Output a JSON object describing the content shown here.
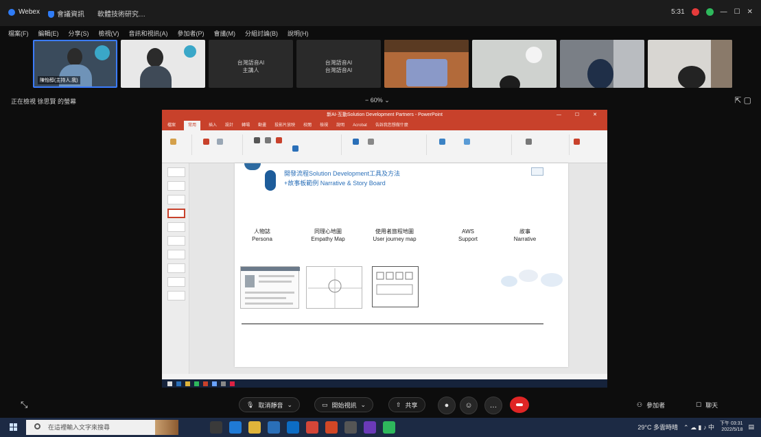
{
  "window": {
    "app_name": "Webex",
    "tab_label": "會議資訊",
    "meeting_name": "軟體技術研究…",
    "time": "5:31",
    "colors": {
      "red_dot": "#e53b3b",
      "green_dot": "#2eb85c"
    }
  },
  "menu": [
    "檔案(F)",
    "編輯(E)",
    "分享(S)",
    "檢視(V)",
    "音訊和視訊(A)",
    "參加者(P)",
    "會議(M)",
    "分組討論(B)",
    "說明(H)"
  ],
  "participants": [
    {
      "kind": "video",
      "label": "陳怡醇(主持人,我)",
      "active": true
    },
    {
      "kind": "video",
      "label": "",
      "active": false
    },
    {
      "kind": "name",
      "name": "台灣語音AI",
      "sub": "主講人",
      "active": false
    },
    {
      "kind": "name",
      "name": "台灣語音AI",
      "sub": "台灣語音AI",
      "active": false
    },
    {
      "kind": "video",
      "label": "",
      "active": false
    },
    {
      "kind": "video",
      "label": "",
      "active": false
    },
    {
      "kind": "video",
      "label": "",
      "active": false
    },
    {
      "kind": "video",
      "label": "",
      "active": false
    }
  ],
  "status": {
    "sharing_text": "正在檢視 徐思賢 的螢幕",
    "zoom": "60%"
  },
  "powerpoint": {
    "title": "新AI-互動Solution Development Partners - PowerPoint",
    "tabs": [
      "檔案",
      "常用",
      "插入",
      "設計",
      "轉場",
      "動畫",
      "投影片放映",
      "校閱",
      "檢視",
      "說明",
      "Acrobat",
      "告訴我您想做什麼"
    ],
    "active_tab": "常用",
    "slide": {
      "title_line1": "開發流程Solution Development工具及方法",
      "title_line2": "+故事板範例 Narrative & Story Board",
      "columns": [
        {
          "zh": "人物誌",
          "en": "Persona"
        },
        {
          "zh": "同理心地圖",
          "en": "Empathy Map"
        },
        {
          "zh": "使用者旅程地圖",
          "en": "User journey map"
        },
        {
          "zh": "AWS",
          "en": "Support"
        },
        {
          "zh": "故事",
          "en": "Narrative"
        }
      ]
    }
  },
  "controls": {
    "mute_label": "取消靜音",
    "video_label": "開始視訊",
    "share_label": "共享",
    "participants_label": "參加者",
    "more_label": "聊天"
  },
  "taskbar": {
    "search_placeholder": "在這裡輸入文字來搜尋",
    "weather": "29°C 多雲時晴",
    "clock_time": "下午 03:31",
    "clock_date": "2022/5/18"
  }
}
